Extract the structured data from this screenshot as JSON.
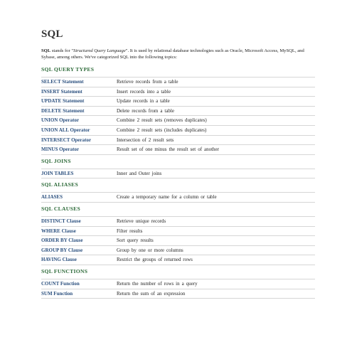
{
  "title": "SQL",
  "intro": {
    "abbr": "SQL",
    "t1": " stands for \"",
    "expansion": "Structured Query Language",
    "t2": "\". It is used by relational database technologies such as Oracle, Microsoft Access, MySQL, and Sybase, among others. We've categorized SQL into the following topics:"
  },
  "sections": [
    {
      "title": "SQL QUERY TYPES",
      "rows": [
        {
          "k": "SELECT Statement",
          "v": "Retrieve records from a table"
        },
        {
          "k": "INSERT Statement",
          "v": "Insert records into a table"
        },
        {
          "k": "UPDATE Statement",
          "v": "Update records in a table"
        },
        {
          "k": "DELETE Statement",
          "v": "Delete records from a table"
        },
        {
          "k": "UNION Operator",
          "v": "Combine 2 result sets (removes duplicates)"
        },
        {
          "k": "UNION ALL Operator",
          "v": "Combine 2 result sets (includes duplicates)"
        },
        {
          "k": "INTERSECT Operator",
          "v": "Intersection of 2 result sets"
        },
        {
          "k": "MINUS Operator",
          "v": "Result set of one minus the result set of another"
        }
      ]
    },
    {
      "title": "SQL JOINS",
      "rows": [
        {
          "k": "JOIN TABLES",
          "v": "Inner and Outer joins"
        }
      ]
    },
    {
      "title": "SQL ALIASES",
      "rows": [
        {
          "k": "ALIASES",
          "v": "Create a temporary name for a column or table"
        }
      ]
    },
    {
      "title": "SQL CLAUSES",
      "rows": [
        {
          "k": "DISTINCT Clause",
          "v": "Retrieve unique records"
        },
        {
          "k": "WHERE Clause",
          "v": "Filter results"
        },
        {
          "k": "ORDER BY Clause",
          "v": "Sort query results"
        },
        {
          "k": "GROUP BY Clause",
          "v": "Group by one or more columns"
        },
        {
          "k": "HAVING Clause",
          "v": "Restrict the groups of returned rows"
        }
      ]
    },
    {
      "title": "SQL FUNCTIONS",
      "rows": [
        {
          "k": "COUNT Function",
          "v": "Return the number of rows in a query"
        },
        {
          "k": "SUM Function",
          "v": "Return the sum of an expression"
        }
      ]
    }
  ]
}
